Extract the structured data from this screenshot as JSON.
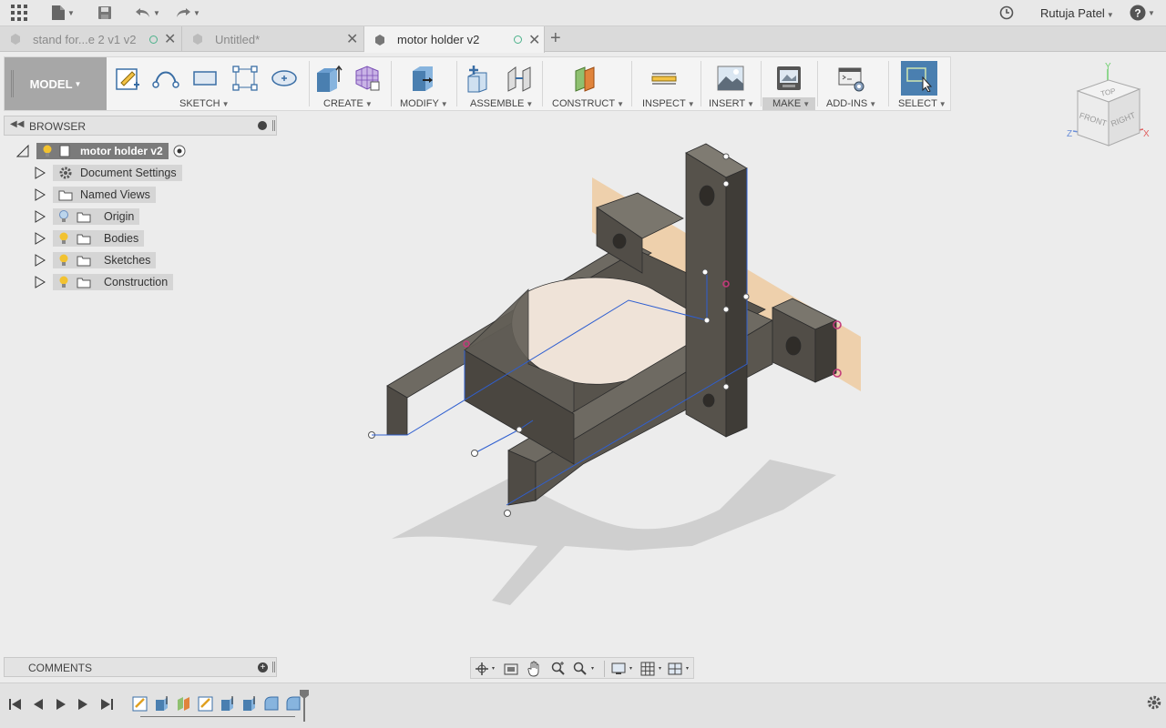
{
  "app": {
    "user_name": "Rutuja Patel"
  },
  "tabs": [
    {
      "label": "stand for...e 2 v1 v2",
      "active": false
    },
    {
      "label": "Untitled*",
      "active": false
    },
    {
      "label": "motor holder v2",
      "active": true
    }
  ],
  "toolbar": {
    "workspace": "MODEL",
    "groups": [
      "SKETCH",
      "CREATE",
      "MODIFY",
      "ASSEMBLE",
      "CONSTRUCT",
      "INSPECT",
      "INSERT",
      "MAKE",
      "ADD-INS",
      "SELECT"
    ]
  },
  "viewcube": {
    "top": "TOP",
    "front": "FRONT",
    "right": "RIGHT",
    "axis_x": "X",
    "axis_y": "Y",
    "axis_z": "Z"
  },
  "browser": {
    "title": "BROWSER",
    "root": "motor holder v2",
    "items": [
      {
        "label": "Document Settings",
        "icon": "gear-icon"
      },
      {
        "label": "Named Views",
        "icon": "folder-icon"
      },
      {
        "label": "Origin",
        "icon": "folder-icon",
        "bulb": "off"
      },
      {
        "label": "Bodies",
        "icon": "folder-icon",
        "bulb": "on"
      },
      {
        "label": "Sketches",
        "icon": "folder-icon",
        "bulb": "on"
      },
      {
        "label": "Construction",
        "icon": "folder-icon",
        "bulb": "on"
      }
    ]
  },
  "comments": {
    "title": "COMMENTS"
  },
  "colors": {
    "accent_select": "#4a7fb0",
    "plane": "#f0b978",
    "bulb_on": "#f2c230",
    "model_face": "#5f5a52"
  }
}
